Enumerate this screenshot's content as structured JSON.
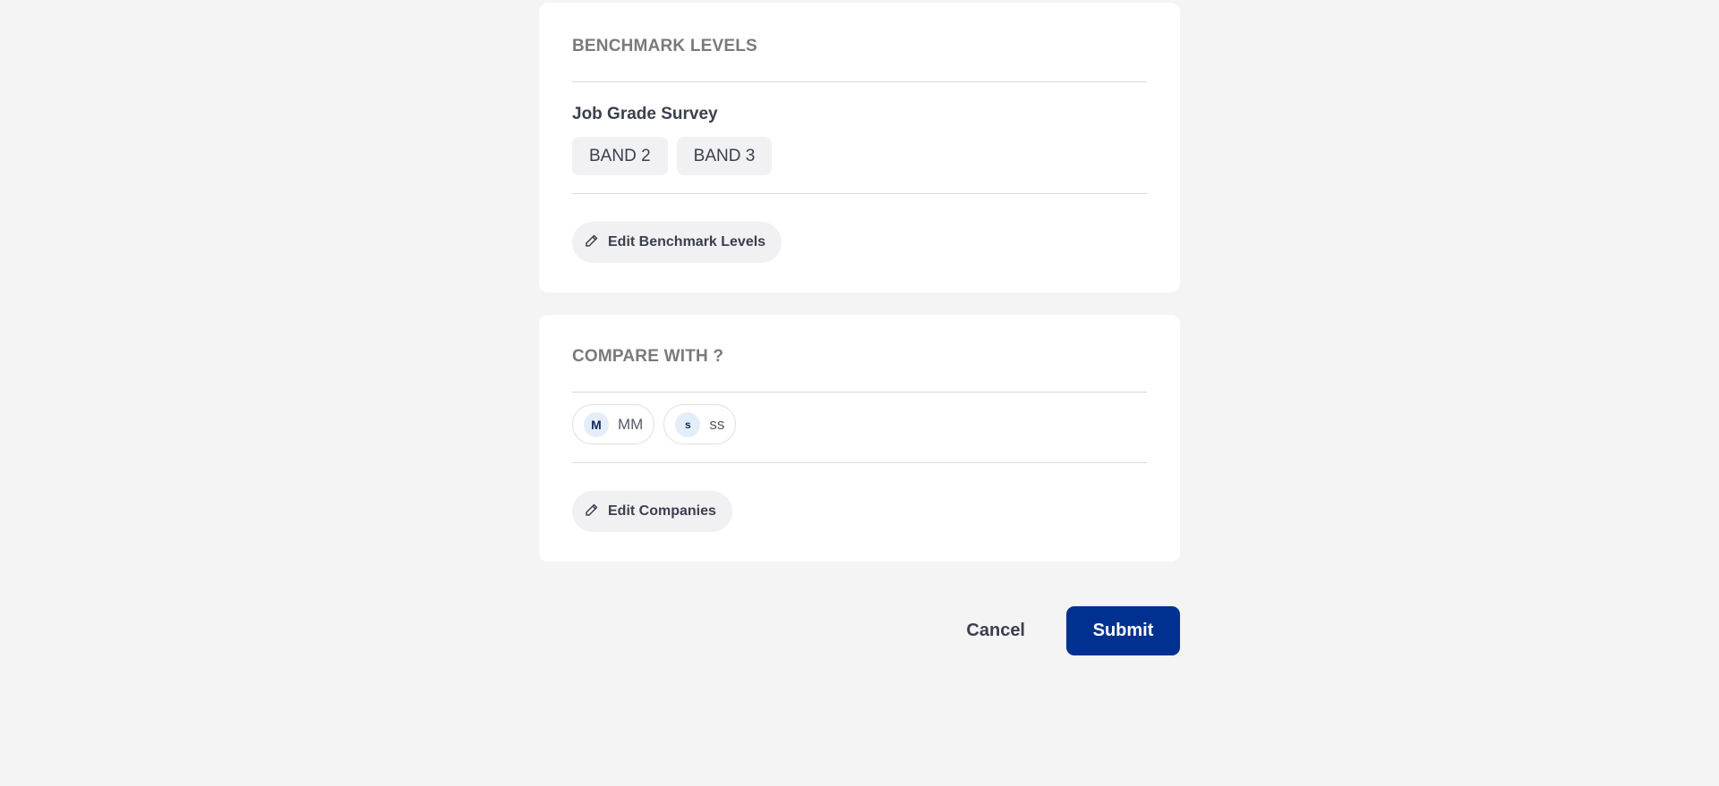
{
  "benchmark": {
    "title": "BENCHMARK LEVELS",
    "survey_label": "Job Grade Survey",
    "bands": [
      "BAND 2",
      "BAND 3"
    ],
    "edit_label": "Edit Benchmark Levels"
  },
  "compare": {
    "title": "COMPARE WITH ?",
    "companies": [
      {
        "initial": "M",
        "name": "MM"
      },
      {
        "initial": "s",
        "name": "ss"
      }
    ],
    "edit_label": "Edit Companies"
  },
  "actions": {
    "cancel_label": "Cancel",
    "submit_label": "Submit"
  },
  "colors": {
    "background": "#f4f4f4",
    "primary": "#003190",
    "avatar_bg": "#e3eefa"
  },
  "icons": {
    "edit": "pencil-icon"
  }
}
